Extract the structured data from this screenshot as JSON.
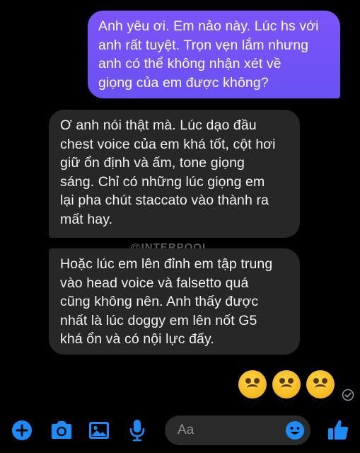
{
  "messages": [
    {
      "direction": "sent",
      "text": "Anh yêu ơi. Em nảo này. Lúc hs với\nanh rất tuyệt. Trọn vẹn lắm nhưng\nanh có thể không nhận xét về\ngiọng của em được không?"
    },
    {
      "direction": "received",
      "text": "Ơ anh nói thật mà. Lúc dạo đầu\nchest voice của em khá tốt, cột hơi\ngiữ ổn định và ấm, tone giọng\nsáng. Chỉ có những lúc giọng em\nlại pha chút staccato vào thành ra\nmất hay."
    },
    {
      "direction": "received",
      "text": "Hoặc lúc em lên đỉnh em tập trung\nvào head voice và falsetto quá\ncũng không nên. Anh thấy được\nnhất là lúc doggy em lên nốt G5\nkhá ổn và có nội lực đấy."
    }
  ],
  "watermark": "@INTERPOOL",
  "reactions": {
    "icon": "upside-down-face-emoji",
    "count": 3
  },
  "composer": {
    "placeholder": "Aa",
    "icons": [
      "plus-icon",
      "camera-icon",
      "image-icon",
      "microphone-icon",
      "emoji-icon",
      "like-icon"
    ]
  },
  "colors": {
    "accent": "#1c8cf8",
    "sent_bubble": "#6e52f5",
    "received_bubble": "#272727",
    "background": "#000000"
  }
}
